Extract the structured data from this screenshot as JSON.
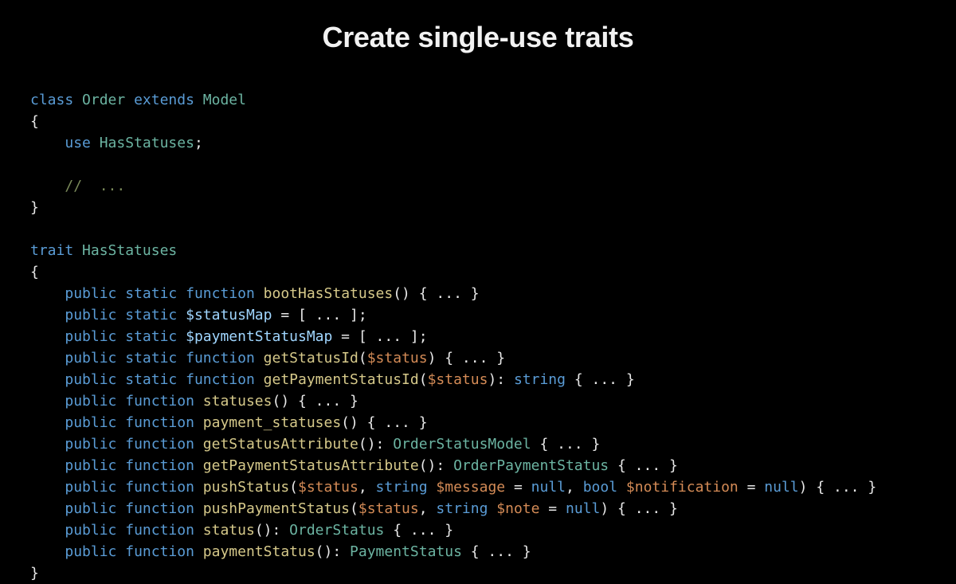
{
  "title": "Create single-use traits",
  "code": {
    "l1a": "class",
    "l1b": "Order",
    "l1c": "extends",
    "l1d": "Model",
    "l2": "{",
    "l3a": "use",
    "l3b": "HasStatuses",
    "l3c": ";",
    "l5": "//  ...",
    "l6": "}",
    "l8a": "trait",
    "l8b": "HasStatuses",
    "l9": "{",
    "l10a": "public",
    "l10b": "static",
    "l10c": "function",
    "l10d": "bootHasStatuses",
    "l10e": "()",
    "l10f": " { ... }",
    "l11a": "public",
    "l11b": "static",
    "l11c": "$statusMap",
    "l11d": " = [ ... ];",
    "l12a": "public",
    "l12b": "static",
    "l12c": "$paymentStatusMap",
    "l12d": " = [ ... ];",
    "l13a": "public",
    "l13b": "static",
    "l13c": "function",
    "l13d": "getStatusId",
    "l13e": "(",
    "l13f": "$status",
    "l13g": ") { ... }",
    "l14a": "public",
    "l14b": "static",
    "l14c": "function",
    "l14d": "getPaymentStatusId",
    "l14e": "(",
    "l14f": "$status",
    "l14g": "): ",
    "l14h": "string",
    "l14i": " { ... }",
    "l15a": "public",
    "l15b": "function",
    "l15c": "statuses",
    "l15d": "() { ... }",
    "l16a": "public",
    "l16b": "function",
    "l16c": "payment_statuses",
    "l16d": "() { ... }",
    "l17a": "public",
    "l17b": "function",
    "l17c": "getStatusAttribute",
    "l17d": "(): ",
    "l17e": "OrderStatusModel",
    "l17f": " { ... }",
    "l18a": "public",
    "l18b": "function",
    "l18c": "getPaymentStatusAttribute",
    "l18d": "(): ",
    "l18e": "OrderPaymentStatus",
    "l18f": " { ... }",
    "l19a": "public",
    "l19b": "function",
    "l19c": "pushStatus",
    "l19d": "(",
    "l19e": "$status",
    "l19f": ", ",
    "l19g": "string",
    "l19h": " ",
    "l19i": "$message",
    "l19j": " = ",
    "l19k": "null",
    "l19l": ", ",
    "l19m": "bool",
    "l19n": " ",
    "l19o": "$notification",
    "l19p": " = ",
    "l19q": "null",
    "l19r": ") { ... }",
    "l20a": "public",
    "l20b": "function",
    "l20c": "pushPaymentStatus",
    "l20d": "(",
    "l20e": "$status",
    "l20f": ", ",
    "l20g": "string",
    "l20h": " ",
    "l20i": "$note",
    "l20j": " = ",
    "l20k": "null",
    "l20l": ") { ... }",
    "l21a": "public",
    "l21b": "function",
    "l21c": "status",
    "l21d": "(): ",
    "l21e": "OrderStatus",
    "l21f": " { ... }",
    "l22a": "public",
    "l22b": "function",
    "l22c": "paymentStatus",
    "l22d": "(): ",
    "l22e": "PaymentStatus",
    "l22f": " { ... }",
    "l23": "}"
  }
}
